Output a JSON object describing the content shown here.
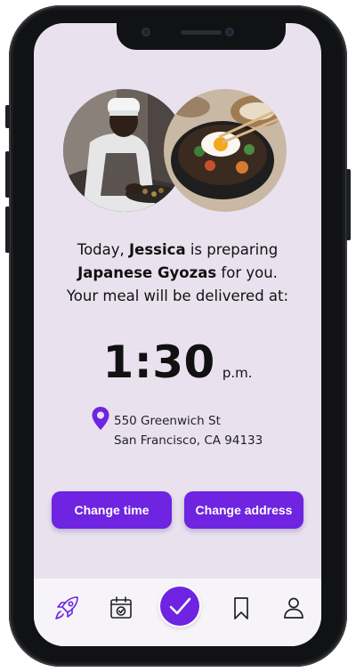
{
  "message": {
    "line1_prefix": "Today, ",
    "chef_name": "Jessica",
    "line1_suffix": " is preparing",
    "dish_name": "Japanese Gyozas",
    "line2_suffix": " for you.",
    "line3": "Your meal will be delivered at:"
  },
  "delivery": {
    "time": "1:30",
    "period": "p.m.",
    "address_line1": "550 Greenwich St",
    "address_line2": "San Francisco, CA 94133"
  },
  "actions": {
    "change_time_label": "Change time",
    "change_address_label": "Change address"
  },
  "tabbar": {
    "items": [
      {
        "icon": "rocket-icon",
        "active": true
      },
      {
        "icon": "calendar-check-icon",
        "active": false
      },
      {
        "icon": "check-icon",
        "active": false
      },
      {
        "icon": "bookmark-icon",
        "active": false
      },
      {
        "icon": "user-icon",
        "active": false
      }
    ]
  },
  "colors": {
    "accent": "#6e24e0",
    "background": "#e9e2ee",
    "text": "#111111"
  }
}
